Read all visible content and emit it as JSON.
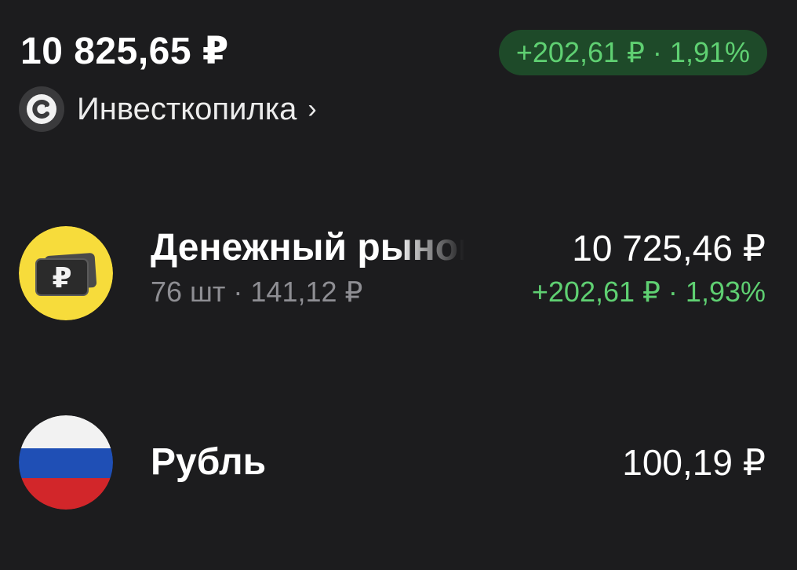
{
  "portfolio": {
    "total_value": "10 825,65 ₽",
    "change": "+202,61 ₽ · 1,91%",
    "account_name": "Инвесткопилка",
    "account_chevron": "›",
    "account_icon": "portfolio-c-icon"
  },
  "holdings": [
    {
      "name": "Денежный рынок",
      "quantity_price": "76 шт · 141,12 ₽",
      "value": "10 725,46 ₽",
      "change": "+202,61 ₽ · 1,93%",
      "icon": "money-market-ruble-icon"
    },
    {
      "name": "Рубль",
      "value": "100,19 ₽",
      "icon": "russian-flag-icon"
    }
  ],
  "colors": {
    "background": "#1c1c1e",
    "positive": "#5fd072",
    "positive_badge_bg": "#1e4a29",
    "muted_text": "#8e8e93",
    "money_market_yellow": "#f7dc3b",
    "flag_white": "#f2f2f2",
    "flag_blue": "#1f4fb5",
    "flag_red": "#d2262a"
  }
}
